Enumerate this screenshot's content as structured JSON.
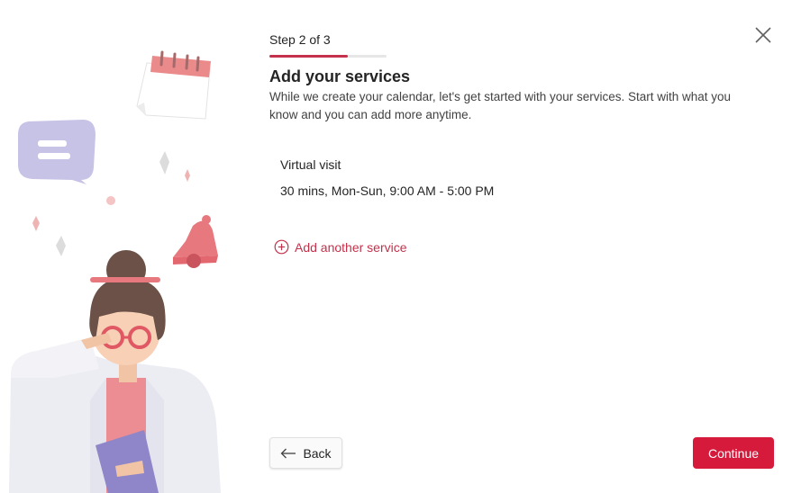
{
  "wizard": {
    "step_label": "Step 2 of 3",
    "progress": 0.67,
    "title": "Add your services",
    "description": "While we create your calendar, let's get started with your services. Start with what you know and you can add more anytime."
  },
  "services": [
    {
      "name": "Virtual visit",
      "detail": "30 mins, Mon-Sun, 9:00 AM - 5:00 PM"
    }
  ],
  "actions": {
    "add_service_label": "Add another service",
    "back_label": "Back",
    "continue_label": "Continue"
  },
  "icons": {
    "close": "close-icon",
    "add": "add-circle-icon",
    "back": "arrow-left-icon"
  },
  "colors": {
    "accent": "#c4314b",
    "primary_button": "#d61a3c",
    "progress_track": "#e6e6e6"
  }
}
